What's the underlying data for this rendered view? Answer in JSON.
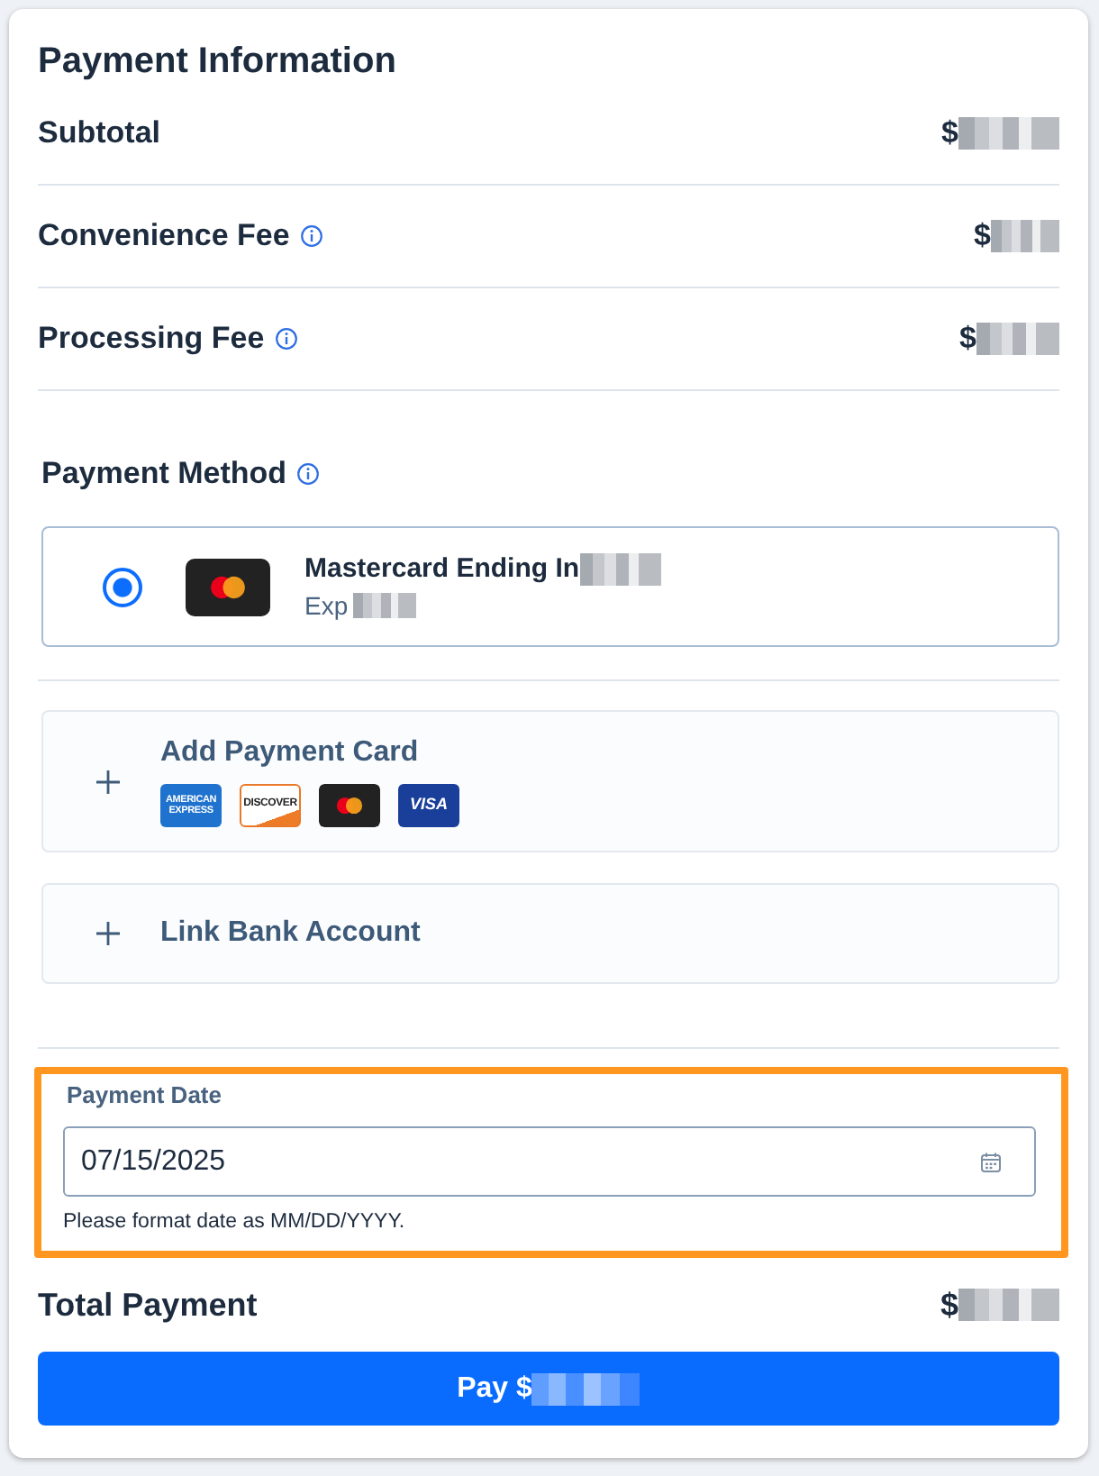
{
  "panel": {
    "title": "Payment Information"
  },
  "fees": [
    {
      "label": "Subtotal",
      "info_icon": false,
      "amount": "$",
      "redacted": true
    },
    {
      "label": "Convenience Fee",
      "info_icon": true,
      "amount": "$",
      "redacted": true
    },
    {
      "label": "Processing Fee",
      "info_icon": true,
      "amount": "$",
      "redacted": true
    }
  ],
  "payment_method": {
    "title": "Payment Method",
    "info_icon": true,
    "saved_cards": [
      {
        "kind": "mastercard",
        "name": "Mastercard Ending In",
        "name_redacted": true,
        "expiry_label": "Exp",
        "expiry_redacted": true,
        "selected": true
      }
    ],
    "add_options": [
      {
        "label": "Add Payment Card",
        "logos": [
          {
            "kind": "amex",
            "text": "AMERICAN EXPRESS"
          },
          {
            "kind": "discover",
            "text": "DISCOVER"
          },
          {
            "kind": "mastercard"
          },
          {
            "kind": "visa",
            "text": "VISA"
          }
        ]
      },
      {
        "label": "Link Bank Account"
      }
    ]
  },
  "payment_date": {
    "label": "Payment Date",
    "value": "07/15/2025",
    "hint": "Please format date as MM/DD/YYYY.",
    "highlighted": true
  },
  "total": {
    "label": "Total Payment",
    "amount": "$",
    "redacted": true
  },
  "pay_button": {
    "label": "Pay $",
    "redacted": true
  }
}
